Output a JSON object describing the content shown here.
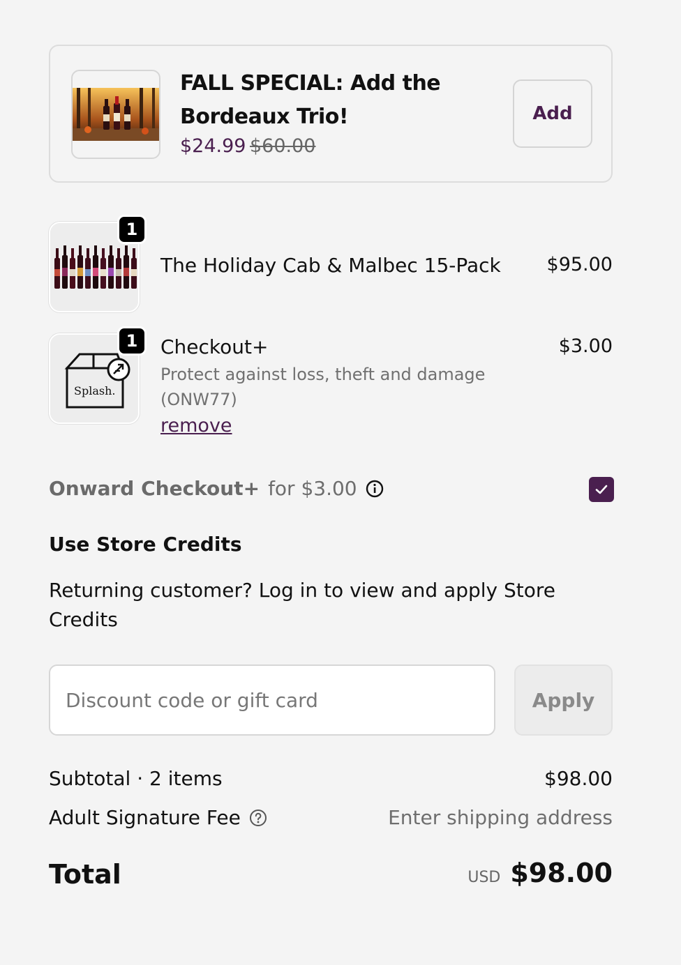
{
  "upsell": {
    "title": "FALL SPECIAL: Add the Bordeaux Trio!",
    "price": "$24.99",
    "compare_price": "$60.00",
    "add_label": "Add"
  },
  "items": [
    {
      "quantity": "1",
      "name": "The Holiday Cab & Malbec 15-Pack",
      "price": "$95.00"
    },
    {
      "quantity": "1",
      "name": "Checkout+",
      "price": "$3.00",
      "description": "Protect against loss, theft and damage (ONW77)",
      "remove_label": "remove",
      "thumb_text": "Splash."
    }
  ],
  "onward": {
    "brand": "Onward Checkout+",
    "text": "for $3.00",
    "checked": true
  },
  "store_credits": {
    "title": "Use Store Credits",
    "text": "Returning customer? Log in to view and apply Store Credits"
  },
  "discount": {
    "placeholder": "Discount code or gift card",
    "value": "",
    "apply_label": "Apply"
  },
  "summary": {
    "subtotal_label": "Subtotal · 2 items",
    "subtotal_value": "$98.00",
    "fee_label": "Adult Signature Fee",
    "fee_value": "Enter shipping address",
    "total_label": "Total",
    "currency": "USD",
    "total_value": "$98.00"
  },
  "colors": {
    "accent": "#4a1f4f",
    "background": "#f4f4f4"
  },
  "icons": [
    "info-icon",
    "help-icon",
    "checkmark-icon",
    "shipping-box-icon"
  ]
}
